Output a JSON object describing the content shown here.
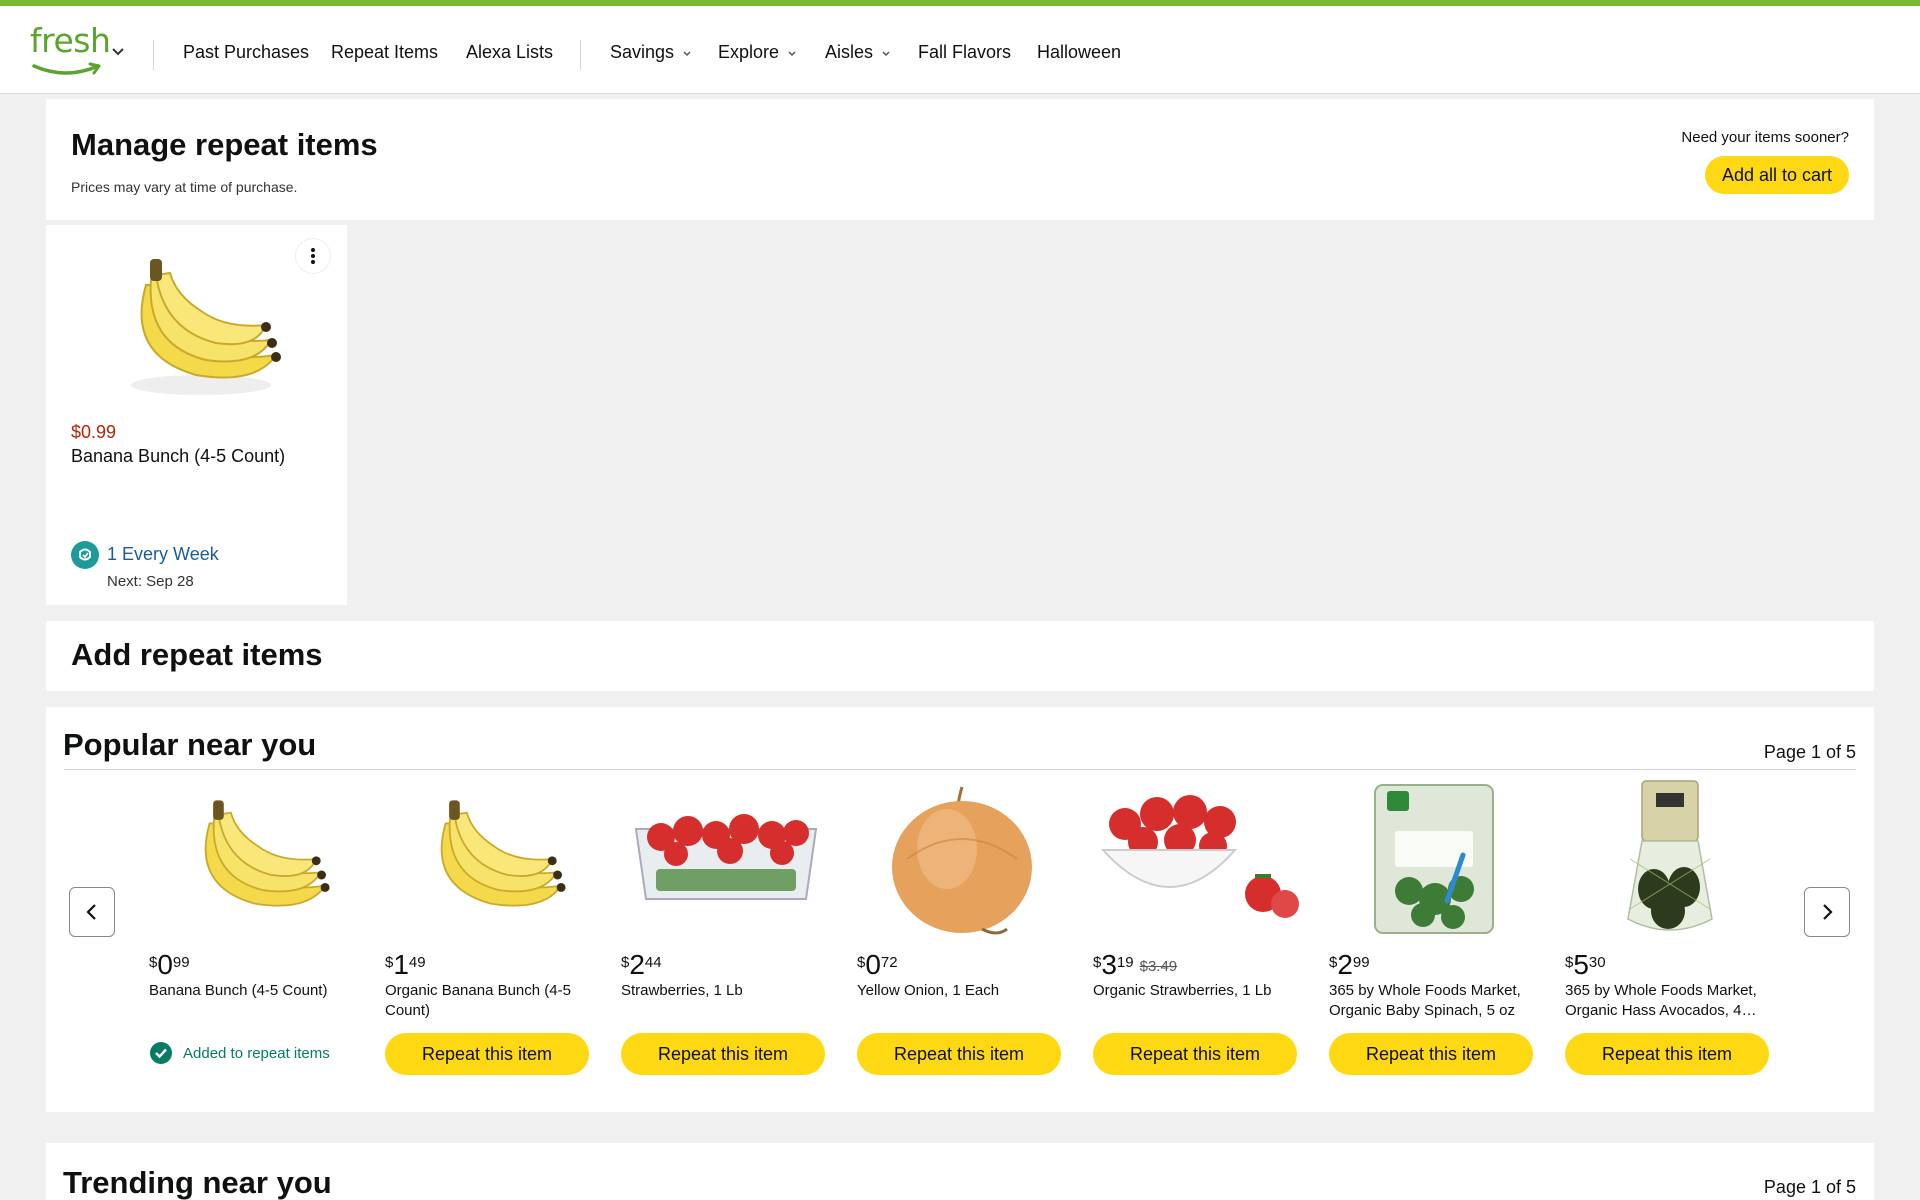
{
  "brand": {
    "name": "fresh",
    "accent": "#7cb82f",
    "logo_color": "#5aa52e"
  },
  "nav": {
    "items": [
      {
        "label": "Past Purchases"
      },
      {
        "label": "Repeat Items"
      },
      {
        "label": "Alexa Lists"
      }
    ],
    "dropdowns": [
      {
        "label": "Savings"
      },
      {
        "label": "Explore"
      },
      {
        "label": "Aisles"
      }
    ],
    "extra": [
      {
        "label": "Fall Flavors"
      },
      {
        "label": "Halloween"
      }
    ]
  },
  "manage": {
    "title": "Manage repeat items",
    "subtitle": "Prices may vary at time of purchase.",
    "sooner_text": "Need your items sooner?",
    "add_all_label": "Add all to cart",
    "item": {
      "price": "$0.99",
      "name": "Banana Bunch (4-5 Count)",
      "frequency": "1 Every Week",
      "next": "Next: Sep 28",
      "image_icon": "banana-image"
    }
  },
  "add_repeat": {
    "title": "Add repeat items"
  },
  "popular": {
    "title": "Popular near you",
    "pager": "Page 1 of 5",
    "products": [
      {
        "sym": "$",
        "whole": "0",
        "frac": "99",
        "old_price": "",
        "name": "Banana Bunch (4-5 Count)",
        "state": "added",
        "added_label": "Added to repeat items",
        "image_icon": "banana-image"
      },
      {
        "sym": "$",
        "whole": "1",
        "frac": "49",
        "old_price": "",
        "name": "Organic Banana Bunch (4-5 Count)",
        "button": "Repeat this item",
        "image_icon": "banana-image"
      },
      {
        "sym": "$",
        "whole": "2",
        "frac": "44",
        "old_price": "",
        "name": "Strawberries, 1 Lb",
        "button": "Repeat this item",
        "image_icon": "strawberry-clamshell-image"
      },
      {
        "sym": "$",
        "whole": "0",
        "frac": "72",
        "old_price": "",
        "name": "Yellow Onion, 1 Each",
        "button": "Repeat this item",
        "image_icon": "onion-image"
      },
      {
        "sym": "$",
        "whole": "3",
        "frac": "19",
        "old_price": "$3.49",
        "name": "Organic Strawberries, 1 Lb",
        "button": "Repeat this item",
        "image_icon": "strawberry-bowl-image"
      },
      {
        "sym": "$",
        "whole": "2",
        "frac": "99",
        "old_price": "",
        "name": "365 by Whole Foods Market, Organic Baby Spinach, 5 oz",
        "button": "Repeat this item",
        "image_icon": "spinach-bag-image"
      },
      {
        "sym": "$",
        "whole": "5",
        "frac": "30",
        "old_price": "",
        "name": "365 by Whole Foods Market, Organic Hass Avocados, 4…",
        "button": "Repeat this item",
        "image_icon": "avocado-bag-image"
      }
    ]
  },
  "trending": {
    "title": "Trending near you",
    "pager": "Page 1 of 5"
  },
  "colors": {
    "button_yellow": "#ffd814",
    "price_red": "#b12704",
    "link_blue": "#1a5d96",
    "success_green": "#067d62"
  }
}
